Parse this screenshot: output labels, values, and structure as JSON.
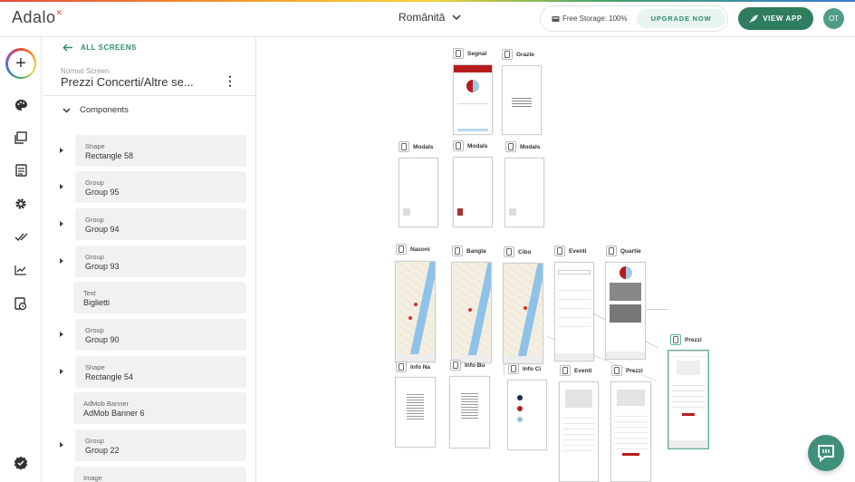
{
  "header": {
    "logo": "Adalo",
    "app_name": "Românitā",
    "storage_text": "Free Storage: 100%",
    "upgrade_label": "UPGRADE NOW",
    "view_app_label": "VIEW APP",
    "avatar_initials": "OT"
  },
  "panel": {
    "back_label": "ALL SCREENS",
    "screen_type": "Normal Screen",
    "screen_name": "Prezzi Concerti/Altre se...",
    "section_label": "Components",
    "components": [
      {
        "type": "Shape",
        "name": "Rectangle 58",
        "expandable": true
      },
      {
        "type": "Group",
        "name": "Group 95",
        "expandable": true
      },
      {
        "type": "Group",
        "name": "Group 94",
        "expandable": true
      },
      {
        "type": "Group",
        "name": "Group 93",
        "expandable": true
      },
      {
        "type": "Text",
        "name": "Biglietti",
        "expandable": false
      },
      {
        "type": "Group",
        "name": "Group 90",
        "expandable": true
      },
      {
        "type": "Shape",
        "name": "Rectangle 54",
        "expandable": true
      },
      {
        "type": "AdMob Banner",
        "name": "AdMob Banner 6",
        "expandable": false
      },
      {
        "type": "Group",
        "name": "Group 22",
        "expandable": true
      },
      {
        "type": "Image",
        "name": "",
        "expandable": false
      }
    ]
  },
  "canvas": {
    "screens": [
      {
        "label": "Segnal"
      },
      {
        "label": "Grazie"
      },
      {
        "label": "Modals"
      },
      {
        "label": "Modals"
      },
      {
        "label": "Modals"
      },
      {
        "label": "Nasoni"
      },
      {
        "label": "Bangla"
      },
      {
        "label": "Cibo"
      },
      {
        "label": "Eventi"
      },
      {
        "label": "Quartie"
      },
      {
        "label": "Prezzi"
      },
      {
        "label": "Info Na"
      },
      {
        "label": "Info Bu"
      },
      {
        "label": "Info Ci"
      },
      {
        "label": "Eventi"
      },
      {
        "label": "Prezzi"
      }
    ]
  },
  "colors": {
    "accent": "#2e7d5e",
    "accent_text": "#2e8c6a",
    "selection": "#5bb39c"
  }
}
